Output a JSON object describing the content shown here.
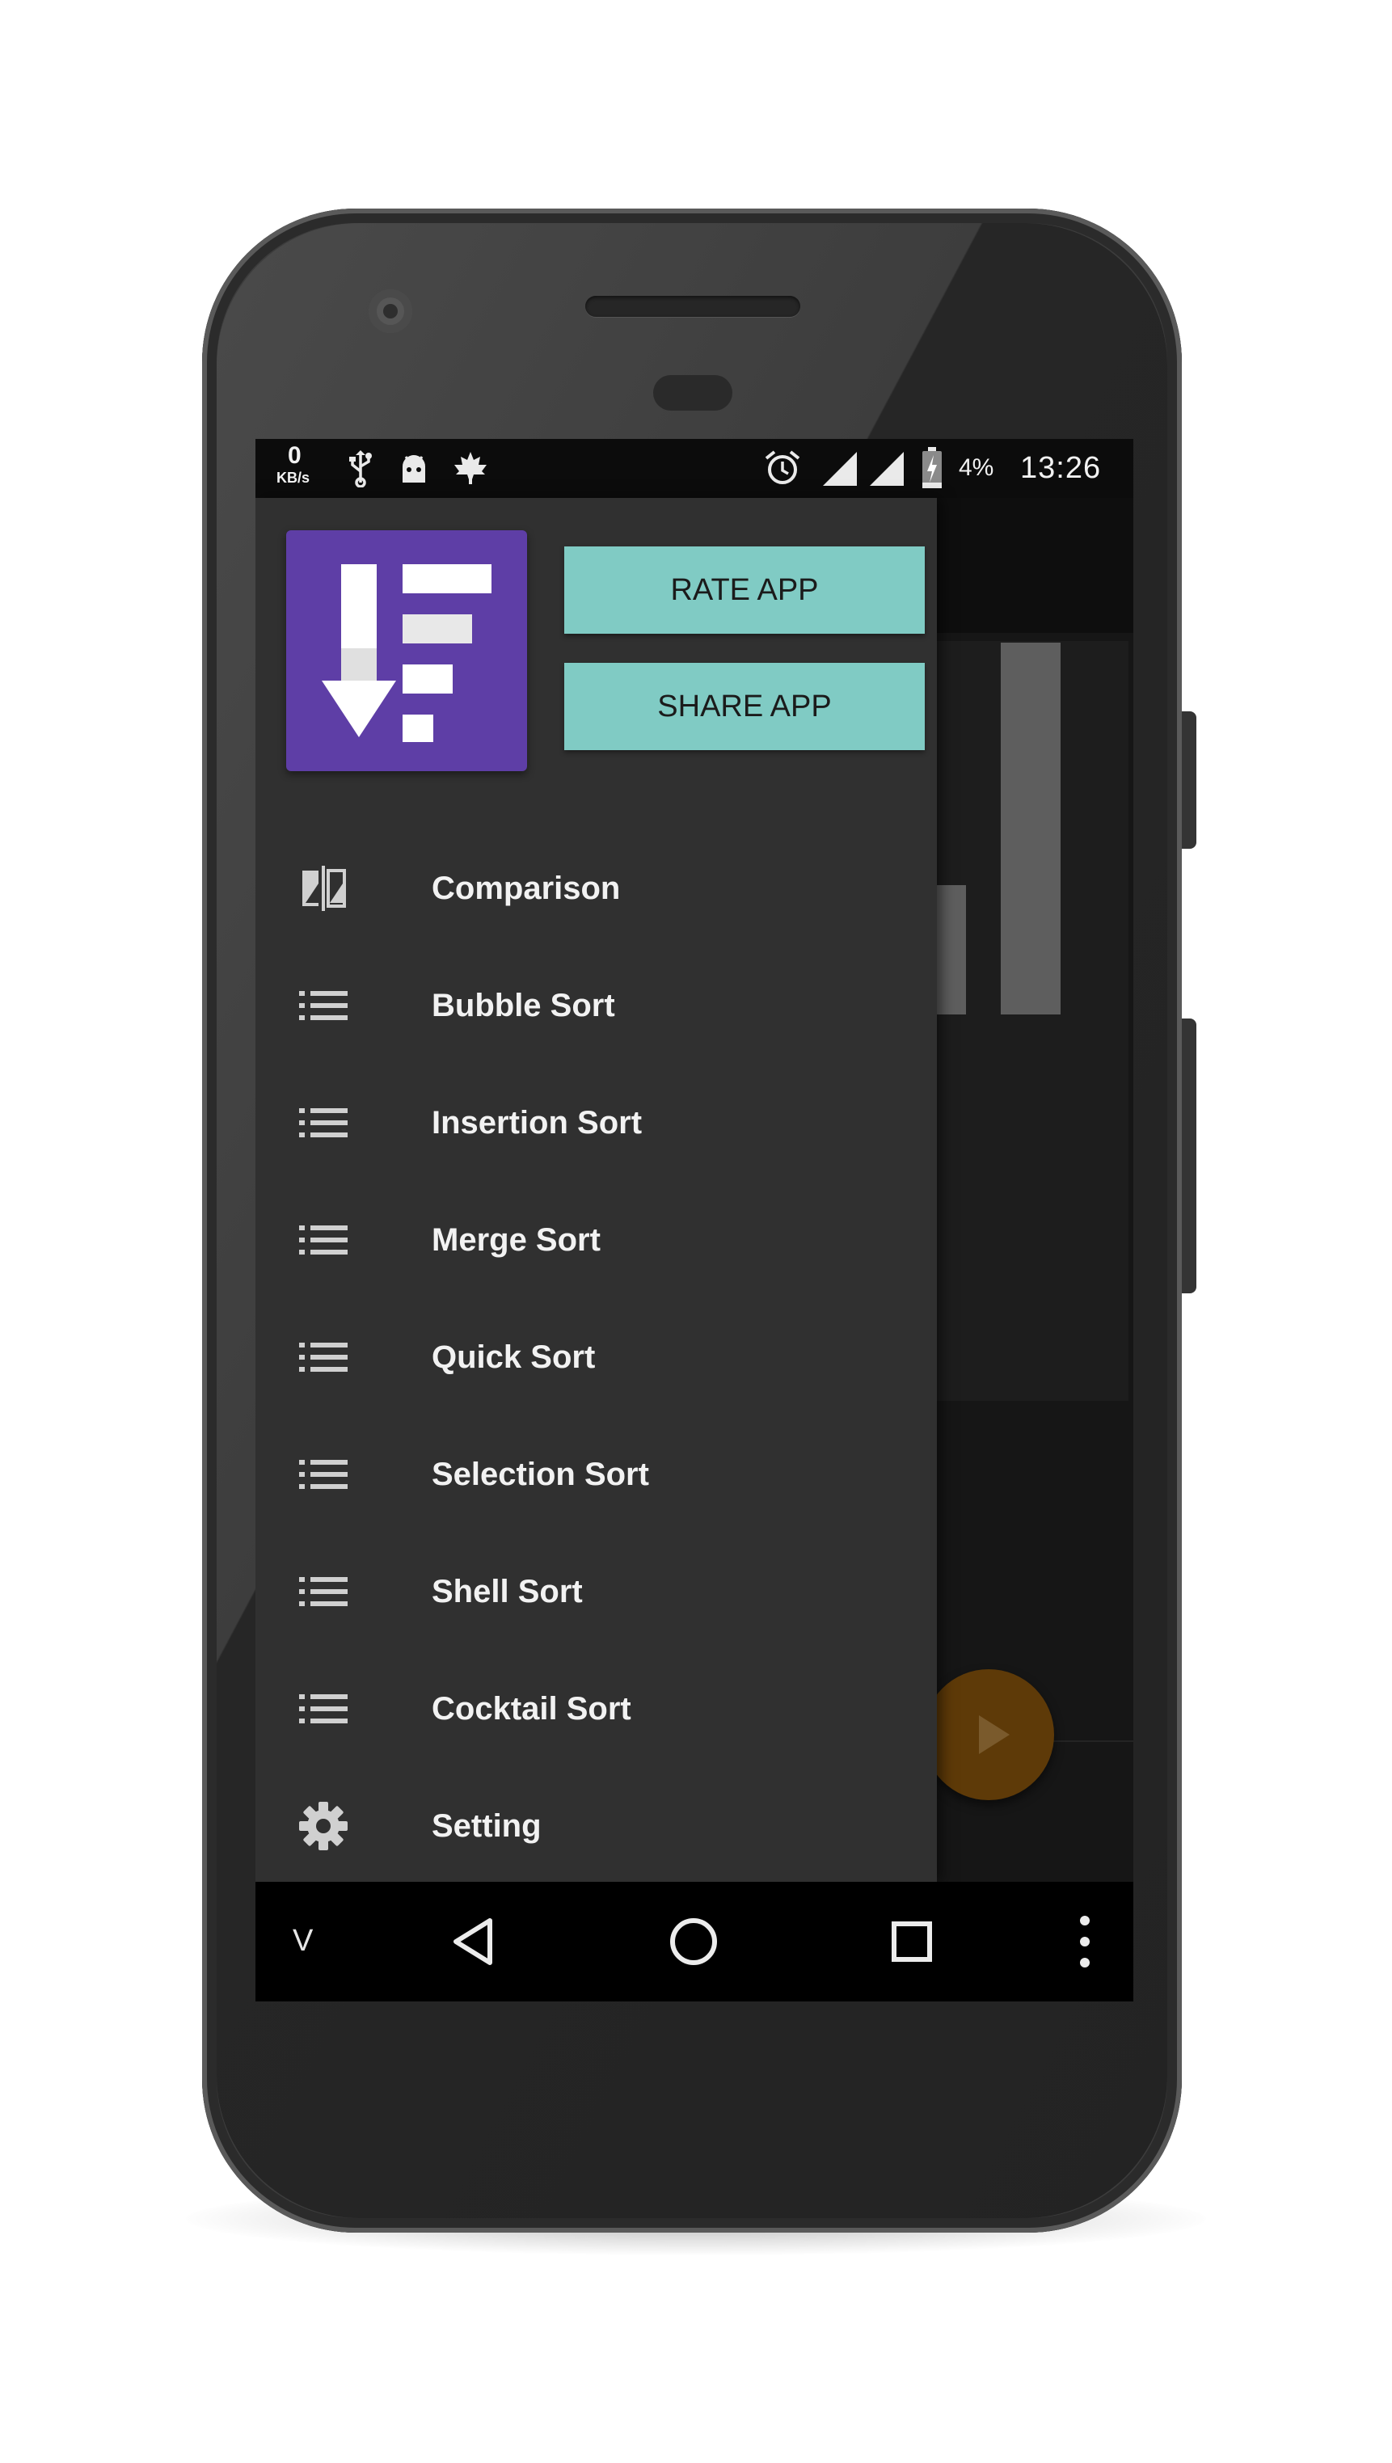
{
  "status_bar": {
    "network_speed_value": "0",
    "network_speed_unit": "KB/s",
    "left_icons": [
      "usb-icon",
      "android-debug-icon",
      "maple-leaf-icon"
    ],
    "right_icons": [
      "alarm-icon",
      "wifi-signal-icon",
      "cell-signal-icon",
      "battery-charging-icon"
    ],
    "battery_percent": "4%",
    "time": "13:26"
  },
  "drawer": {
    "logo_icon": "sort-descending-app-logo",
    "rate_button": "RATE APP",
    "share_button": "SHARE APP",
    "items": [
      {
        "label": "Comparison",
        "icon": "compare-icon"
      },
      {
        "label": "Bubble Sort",
        "icon": "list-icon"
      },
      {
        "label": "Insertion Sort",
        "icon": "list-icon"
      },
      {
        "label": "Merge Sort",
        "icon": "list-icon"
      },
      {
        "label": "Quick Sort",
        "icon": "list-icon"
      },
      {
        "label": "Selection Sort",
        "icon": "list-icon"
      },
      {
        "label": "Shell Sort",
        "icon": "list-icon"
      },
      {
        "label": "Cocktail Sort",
        "icon": "list-icon"
      },
      {
        "label": "Setting",
        "icon": "gear-icon"
      }
    ]
  },
  "background_app": {
    "fab_icon": "play-icon"
  },
  "nav_bar": {
    "collapse_label": "V",
    "buttons": [
      "back-icon",
      "home-icon",
      "recents-icon",
      "more-vert-icon"
    ]
  },
  "colors": {
    "drawer_bg": "#303030",
    "logo_bg": "#5e3ea6",
    "button_bg": "#80cbc4",
    "fab_bg": "#5e3a08",
    "screen_bg": "#161616"
  }
}
